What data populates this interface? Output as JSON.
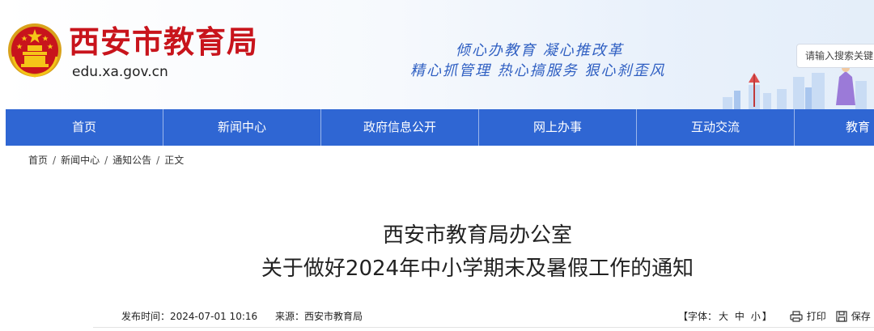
{
  "header": {
    "title": "西安市教育局",
    "domain": "edu.xa.gov.cn",
    "slogan_line1": "倾心办教育  凝心推改革",
    "slogan_line2": "精心抓管理  热心搞服务  狠心刹歪风",
    "emblem_icon": "national-emblem-icon",
    "search_placeholder": "请输入搜索关键"
  },
  "nav": {
    "items": [
      "首页",
      "新闻中心",
      "政府信息公开",
      "网上办事",
      "互动交流",
      "教育"
    ]
  },
  "breadcrumb": {
    "items": [
      "首页",
      "新闻中心",
      "通知公告",
      "正文"
    ],
    "separator": "/"
  },
  "article": {
    "title_line1": "西安市教育局办公室",
    "title_line2": "关于做好2024年中小学期末及暑假工作的通知",
    "publish_time": "发布时间：2024-07-01 10:16",
    "source": "来源：西安市教育局",
    "font_size_label": "【字体：",
    "font_large": "大",
    "font_medium": "中",
    "font_small": "小",
    "font_size_close": "】",
    "print_label": "打印",
    "save_label": "保存"
  },
  "colors": {
    "title_red": "#c8141c",
    "nav_blue": "#2f66d3",
    "slogan_blue": "#2f5fc2"
  }
}
